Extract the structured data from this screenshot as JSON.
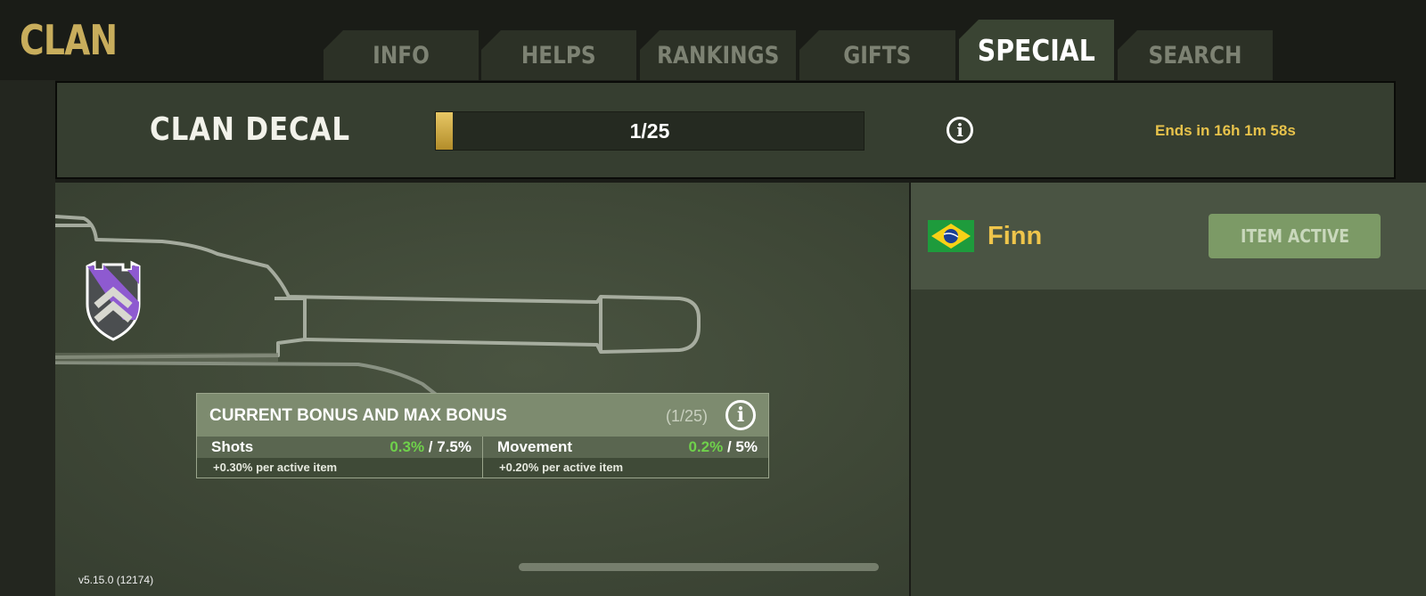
{
  "header": {
    "title": "CLAN"
  },
  "tabs": [
    {
      "label": "INFO",
      "active": false
    },
    {
      "label": "HELPS",
      "active": false
    },
    {
      "label": "RANKINGS",
      "active": false
    },
    {
      "label": "GIFTS",
      "active": false
    },
    {
      "label": "SPECIAL",
      "active": true
    },
    {
      "label": "SEARCH",
      "active": false
    }
  ],
  "decal": {
    "title": "CLAN DECAL",
    "progress_text": "1/25",
    "progress_fraction": 0.04,
    "info_icon": "info-icon",
    "ends_text": "Ends in 16h 1m 58s"
  },
  "bonus": {
    "title": "CURRENT BONUS AND MAX BONUS",
    "count": "(1/25)",
    "info_icon": "info-icon",
    "stats": [
      {
        "label": "Shots",
        "current": "0.3%",
        "sep": " / ",
        "max": "7.5%",
        "per_item": "+0.30% per active item"
      },
      {
        "label": "Movement",
        "current": "0.2%",
        "sep": " / ",
        "max": "5%",
        "per_item": "+0.20% per active item"
      }
    ]
  },
  "player": {
    "name": "Finn",
    "flag": "brazil-flag-icon",
    "button_label": "ITEM ACTIVE"
  },
  "footer": {
    "version": "v5.15.0 (12174)"
  },
  "colors": {
    "accent_gold": "#efc54b",
    "bonus_green": "#6fd14b",
    "item_active_bg": "#7c9a66",
    "decal_purple": "#8e5ad0"
  }
}
